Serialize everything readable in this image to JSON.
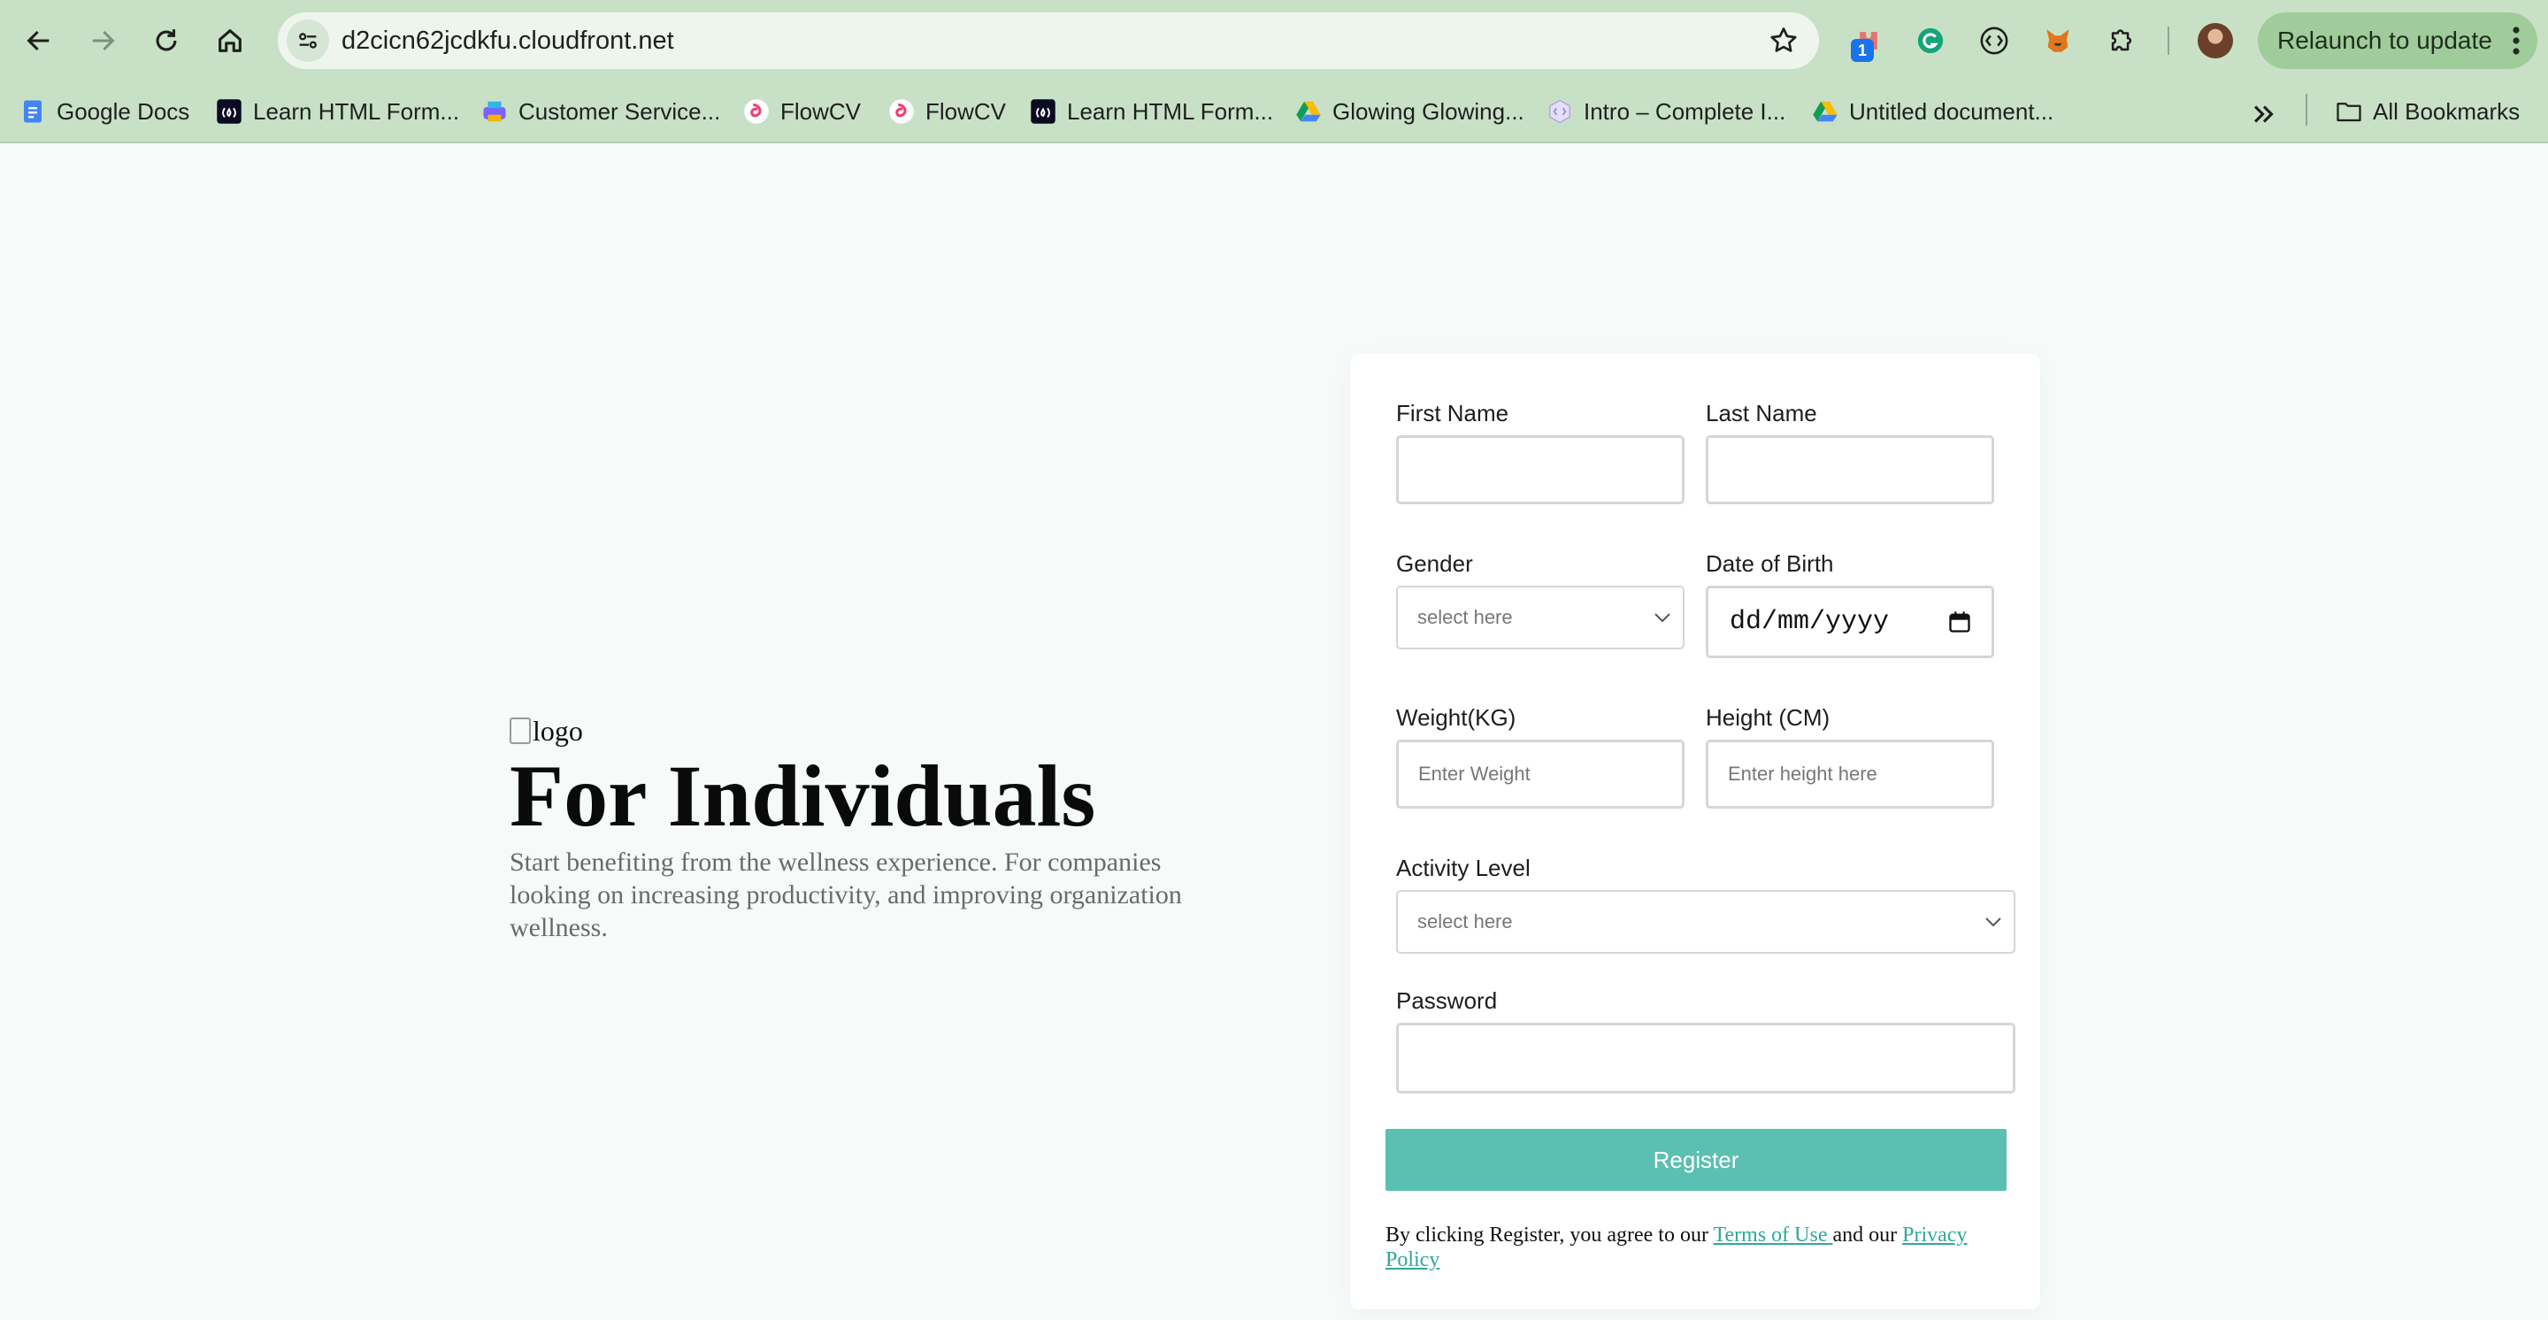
{
  "browser": {
    "url": "d2cicn62jcdkfu.cloudfront.net",
    "extension_badge": "1",
    "relaunch_label": "Relaunch to update",
    "bookmarks": [
      {
        "label": "Google Docs",
        "icon": "google-docs-icon"
      },
      {
        "label": "Learn HTML Form...",
        "icon": "freecodecamp-icon"
      },
      {
        "label": "Customer Service...",
        "icon": "printer-icon"
      },
      {
        "label": "FlowCV",
        "icon": "flowcv-icon"
      },
      {
        "label": "FlowCV",
        "icon": "flowcv-icon"
      },
      {
        "label": "Learn HTML Form...",
        "icon": "freecodecamp-icon"
      },
      {
        "label": "Glowing Glowing...",
        "icon": "google-drive-icon"
      },
      {
        "label": "Intro – Complete I...",
        "icon": "hexagon-icon"
      },
      {
        "label": "Untitled document...",
        "icon": "google-drive-icon"
      }
    ],
    "all_bookmarks_label": "All Bookmarks"
  },
  "hero": {
    "logo_alt": "logo",
    "title": "For Individuals",
    "description": "Start benefiting from the wellness experience. For companies looking on increasing productivity, and improving organization wellness."
  },
  "form": {
    "first_name_label": "First Name",
    "last_name_label": "Last Name",
    "gender_label": "Gender",
    "gender_value": "select here",
    "dob_label": "Date of Birth",
    "dob_placeholder": "dd/mm/yyyy",
    "weight_label": "Weight(KG)",
    "weight_placeholder": "Enter Weight",
    "height_label": "Height (CM)",
    "height_placeholder": "Enter height here",
    "activity_label": "Activity Level",
    "activity_value": "select here",
    "password_label": "Password",
    "register_label": "Register",
    "terms_prefix": "By clicking Register, you agree to our ",
    "terms_link": "Terms of Use ",
    "terms_middle": "and our ",
    "privacy_link": "Privacy Policy"
  },
  "colors": {
    "chrome_bg": "#c8e1c6",
    "page_bg": "#f6faf9",
    "accent": "#5bbfb1"
  }
}
